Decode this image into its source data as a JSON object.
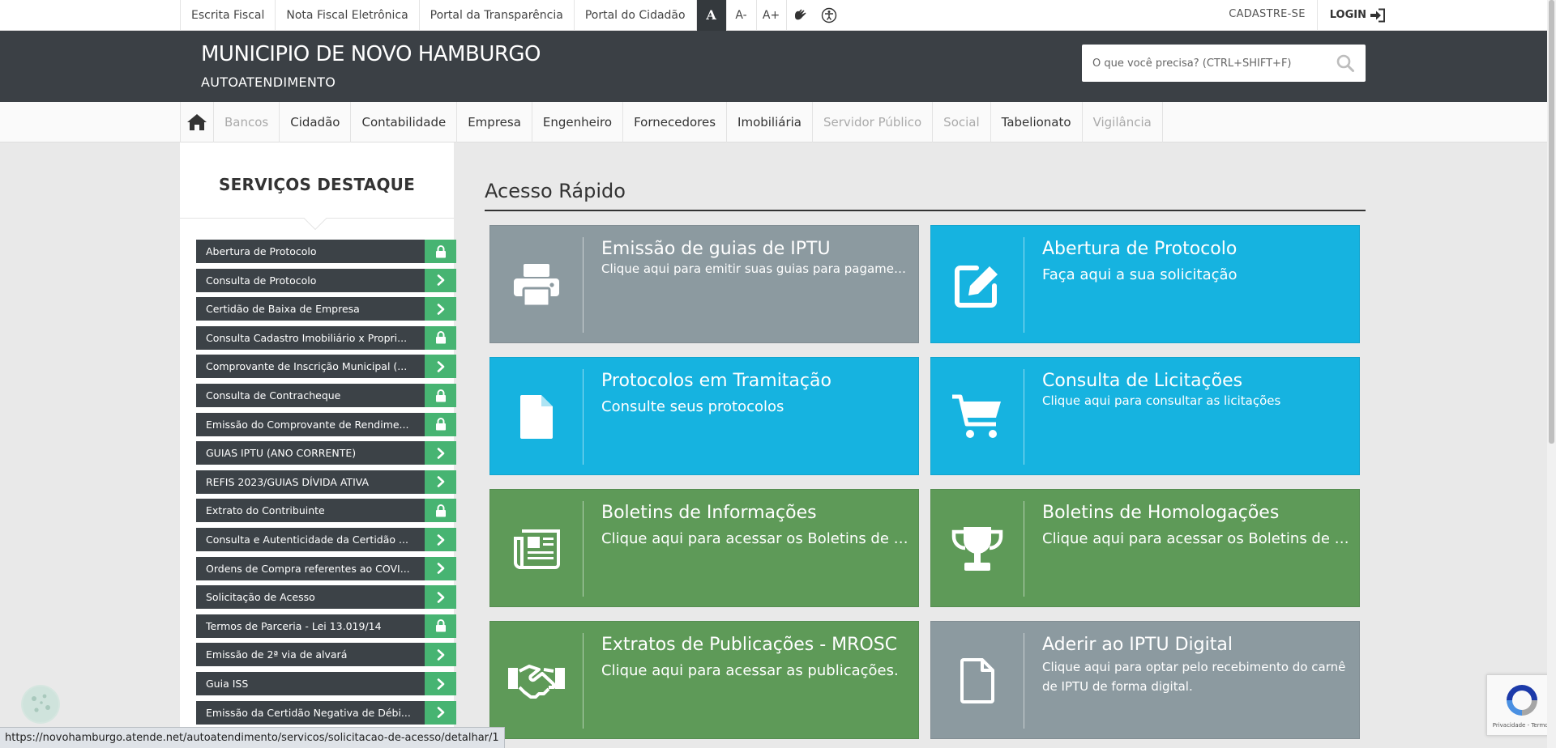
{
  "topbar": {
    "links": [
      "Escrita Fiscal",
      "Nota Fiscal Eletrônica",
      "Portal da Transparência",
      "Portal do Cidadão"
    ],
    "font_normal": "A",
    "font_decrease": "A-",
    "font_increase": "A+",
    "signup": "CADASTRE-SE",
    "login": "LOGIN"
  },
  "header": {
    "title": "MUNICIPIO DE NOVO HAMBURGO",
    "subtitle": "AUTOATENDIMENTO",
    "search_placeholder": "O que você precisa? (CTRL+SHIFT+F)"
  },
  "nav": {
    "items": [
      "Bancos",
      "Cidadão",
      "Contabilidade",
      "Empresa",
      "Engenheiro",
      "Fornecedores",
      "Imobiliária",
      "Servidor Público",
      "Social",
      "Tabelionato",
      "Vigilância"
    ]
  },
  "sidebar": {
    "title": "SERVIÇOS DESTAQUE",
    "services": [
      {
        "label": "Abertura de Protocolo",
        "icon": "lock-icon"
      },
      {
        "label": "Consulta de Protocolo",
        "icon": "chevron-right-icon"
      },
      {
        "label": "Certidão de Baixa de Empresa",
        "icon": "chevron-right-icon"
      },
      {
        "label": "Consulta Cadastro Imobiliário x Propri...",
        "icon": "lock-icon"
      },
      {
        "label": "Comprovante de Inscrição Municipal (...",
        "icon": "chevron-right-icon"
      },
      {
        "label": "Consulta de Contracheque",
        "icon": "lock-icon"
      },
      {
        "label": "Emissão do Comprovante de Rendime...",
        "icon": "lock-icon"
      },
      {
        "label": "GUIAS IPTU (ANO CORRENTE)",
        "icon": "chevron-right-icon"
      },
      {
        "label": "REFIS 2023/GUIAS DÍVIDA ATIVA",
        "icon": "chevron-right-icon"
      },
      {
        "label": "Extrato do Contribuinte",
        "icon": "lock-icon"
      },
      {
        "label": "Consulta e Autenticidade da Certidão ...",
        "icon": "chevron-right-icon"
      },
      {
        "label": "Ordens de Compra referentes ao COVI...",
        "icon": "chevron-right-icon"
      },
      {
        "label": "Solicitação de Acesso",
        "icon": "chevron-right-icon"
      },
      {
        "label": "Termos de Parceria - Lei 13.019/14",
        "icon": "lock-icon"
      },
      {
        "label": "Emissão de 2ª via de alvará",
        "icon": "chevron-right-icon"
      },
      {
        "label": "Guia ISS",
        "icon": "chevron-right-icon"
      },
      {
        "label": "Emissão da Certidão Negativa de Débi...",
        "icon": "chevron-right-icon"
      }
    ]
  },
  "main": {
    "title": "Acesso Rápido",
    "tiles": [
      {
        "title": "Emissão de guias de IPTU",
        "desc": "Clique aqui para emitir suas guias para pagamento ...",
        "icon": "printer-icon",
        "color": "#8c9aa0"
      },
      {
        "title": "Abertura de Protocolo",
        "desc": "Faça aqui a sua solicitação",
        "icon": "edit-icon",
        "color": "#16b3e0"
      },
      {
        "title": "Protocolos em Tramitação",
        "desc": "Consulte seus protocolos",
        "icon": "file-icon",
        "color": "#16b3e0"
      },
      {
        "title": "Consulta de Licitações",
        "desc": "Clique aqui para consultar as licitações",
        "icon": "cart-icon",
        "color": "#16b3e0"
      },
      {
        "title": "Boletins de Informações",
        "desc": "Clique aqui para acessar os Boletins de In...",
        "icon": "newspaper-icon",
        "color": "#5e9a58"
      },
      {
        "title": "Boletins de Homologações",
        "desc": "Clique aqui para acessar os Boletins de H...",
        "icon": "trophy-icon",
        "color": "#5e9a58"
      },
      {
        "title": "Extratos de Publicações - MROSC",
        "desc": "Clique aqui para acessar as publicações.",
        "icon": "handshake-icon",
        "color": "#5e9a58"
      },
      {
        "title": "Aderir ao IPTU Digital",
        "desc": "Clique aqui para optar pelo recebimento do carnê de IPTU de forma digital.",
        "icon": "document-outline-icon",
        "color": "#8c9aa0"
      }
    ]
  },
  "status_url": "https://novohamburgo.atende.net/autoatendimento/servicos/solicitacao-de-acesso/detalhar/1",
  "recaptcha_text": "Privacidade - Termos",
  "colors": {
    "header": "#3b4045",
    "accent_green": "#47b472",
    "tile_blue": "#16b3e0",
    "tile_green": "#5e9a58",
    "tile_gray": "#8c9aa0"
  }
}
